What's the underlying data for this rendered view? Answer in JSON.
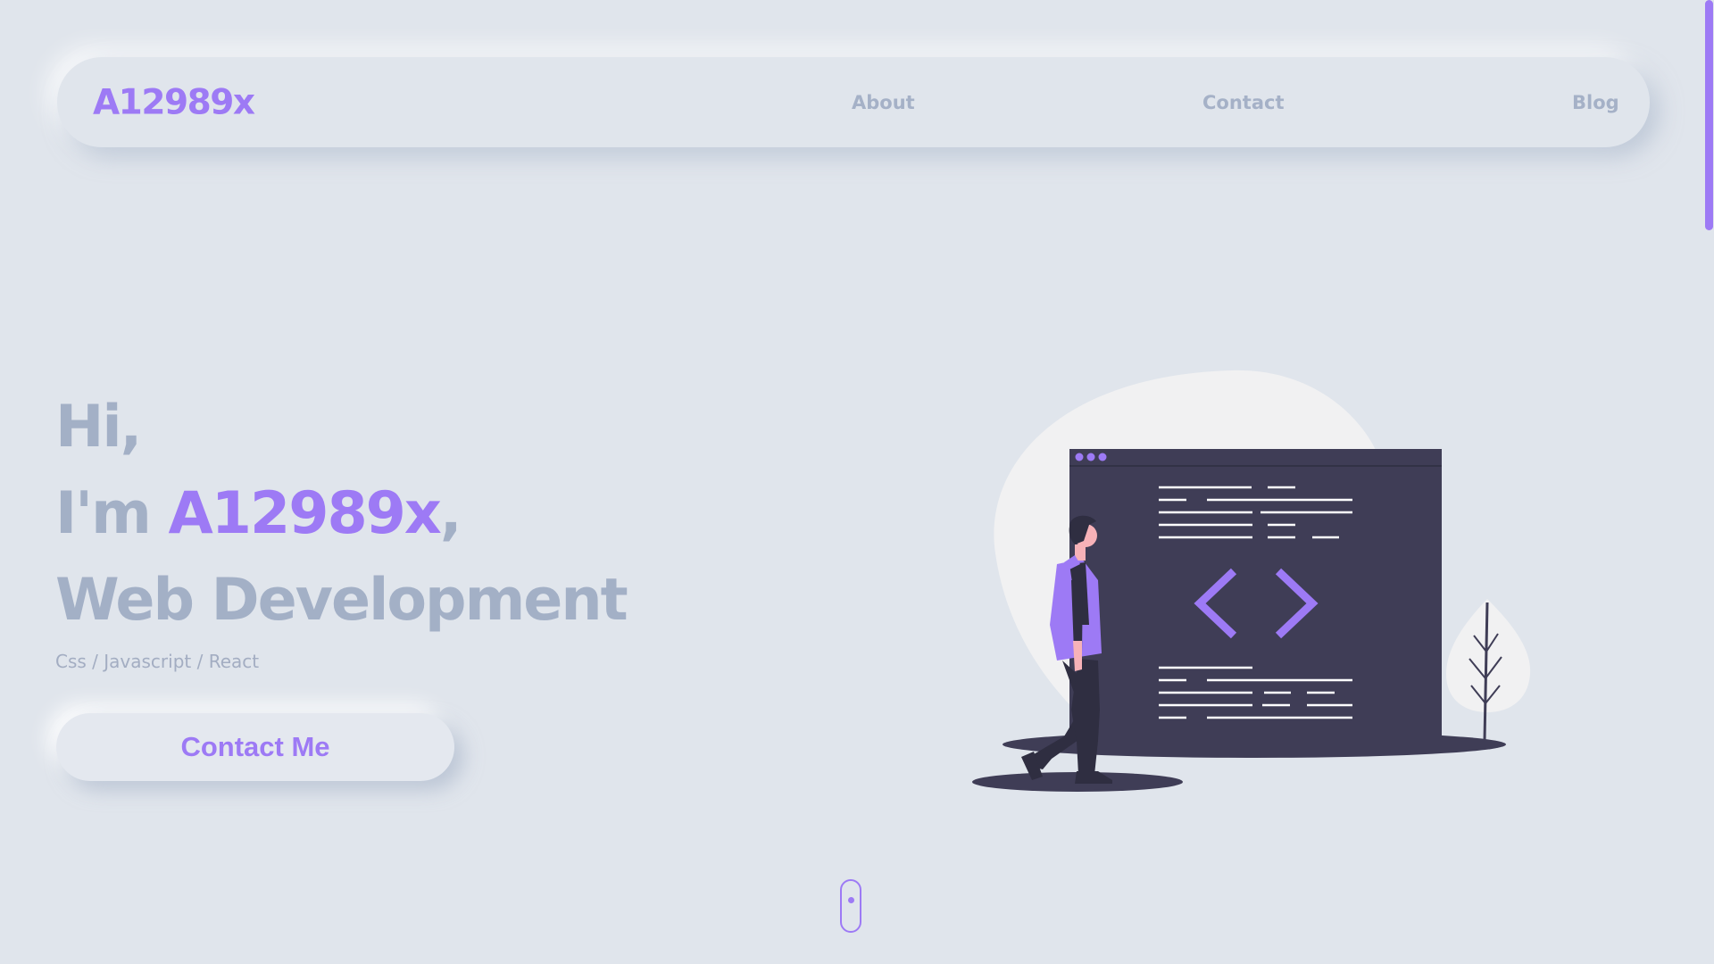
{
  "brand": {
    "logo": "A12989x",
    "accent_color": "#9d7af5",
    "muted_text_color": "#a3b0c6",
    "background_color": "#e0e5ec"
  },
  "nav": {
    "items": [
      {
        "label": "About"
      },
      {
        "label": "Contact"
      },
      {
        "label": "Blog"
      }
    ]
  },
  "hero": {
    "line1": "Hi,",
    "line2_prefix": "I'm ",
    "line2_name": "A12989x",
    "line2_suffix": ",",
    "line3": "Web Development",
    "skills": "Css / Javascript / React",
    "cta_label": "Contact Me"
  },
  "illustration": {
    "subject": "person walking beside code editor window",
    "icons": [
      "code-brackets-icon",
      "tree-icon",
      "person-icon"
    ]
  },
  "scroll_indicator": {
    "icon": "mouse-scroll-icon"
  }
}
